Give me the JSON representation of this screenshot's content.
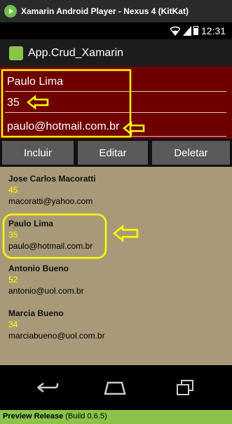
{
  "window": {
    "title": "Xamarin Android Player - Nexus 4 (KitKat)"
  },
  "status_bar": {
    "time": "12:31"
  },
  "action_bar": {
    "title": "App.Crud_Xamarin",
    "icon": "android-app-icon"
  },
  "form": {
    "name_value": "Paulo Lima",
    "age_value": "35",
    "email_value": "paulo@hotmail.com.br"
  },
  "buttons": {
    "incluir": "Incluir",
    "editar": "Editar",
    "deletar": "Deletar"
  },
  "contacts": [
    {
      "name": "Jose Carlos Macoratti",
      "age": "45",
      "email": "macoratti@yahoo.com"
    },
    {
      "name": "Paulo Lima",
      "age": "35",
      "email": "paulo@hotmail.com.br"
    },
    {
      "name": "Antonio Bueno",
      "age": "52",
      "email": "antonio@uol.com.br"
    },
    {
      "name": "Marcia Bueno",
      "age": "34",
      "email": "marciabueno@uol.com.br"
    }
  ],
  "footer": {
    "label": "Preview Release",
    "build": "(Build 0.6.5)"
  },
  "colors": {
    "form_background": "#6e0000",
    "list_background": "#a89a78",
    "age_text": "#ffff00",
    "annotation": "#ffff00",
    "footer_background": "#8bc34a"
  }
}
